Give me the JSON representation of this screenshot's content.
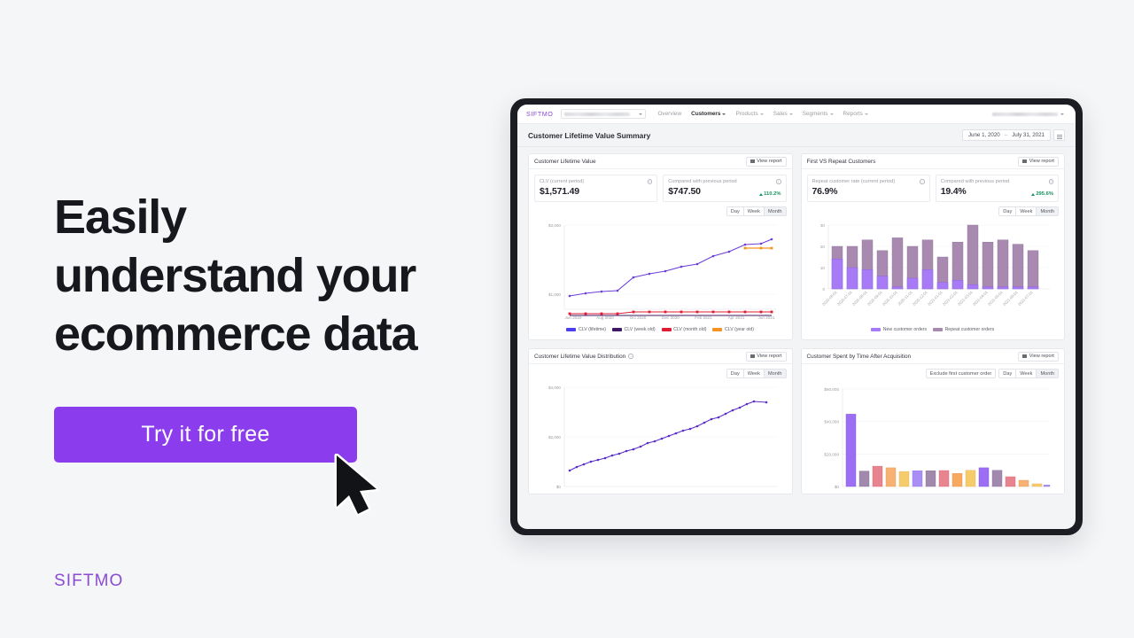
{
  "hero": {
    "headline_lines": [
      "Easily",
      "understand your",
      "ecommerce data"
    ],
    "cta_label": "Try it for free",
    "brand": "SIFTMO",
    "cta_color": "#8b3dee",
    "brand_color": "#8b4ad4"
  },
  "app": {
    "brand": "SIFTMO",
    "store_selector_value": "",
    "nav": [
      {
        "label": "Overview",
        "caret": false,
        "active": false
      },
      {
        "label": "Customers",
        "caret": true,
        "active": true
      },
      {
        "label": "Products",
        "caret": true,
        "active": false
      },
      {
        "label": "Sales",
        "caret": true,
        "active": false
      },
      {
        "label": "Segments",
        "caret": true,
        "active": false
      },
      {
        "label": "Reports",
        "caret": true,
        "active": false
      }
    ],
    "page_title": "Customer Lifetime Value Summary",
    "date_start": "June 1, 2020",
    "date_end": "July 31, 2021",
    "date_separator": "–",
    "view_report_label": "View report"
  },
  "cards": {
    "clv": {
      "title": "Customer Lifetime Value",
      "kpis": [
        {
          "label": "CLV (current period)",
          "value": "$1,571.49",
          "delta": null
        },
        {
          "label": "Compared with previous period",
          "value": "$747.50",
          "delta": "110.2%"
        }
      ],
      "toggle": [
        "Day",
        "Week",
        "Month"
      ],
      "toggle_selected": "Month"
    },
    "repeat": {
      "title": "First VS Repeat Customers",
      "kpis": [
        {
          "label": "Repeat customer rate (current period)",
          "value": "76.9%",
          "delta": null
        },
        {
          "label": "Compared with previous period",
          "value": "19.4%",
          "delta": "295.6%"
        }
      ],
      "toggle": [
        "Day",
        "Week",
        "Month"
      ],
      "toggle_selected": "Month"
    },
    "distribution": {
      "title": "Customer Lifetime Value Distribution",
      "has_info": true,
      "toggle": [
        "Day",
        "Week",
        "Month"
      ],
      "toggle_selected": "Month"
    },
    "spent": {
      "title": "Customer Spent by Time After Acquisition",
      "exclude_label": "Exclude first customer order",
      "toggle": [
        "Day",
        "Week",
        "Month"
      ],
      "toggle_selected": "Month"
    }
  },
  "chart_data": [
    {
      "id": "clv-line",
      "type": "line",
      "title": "Customer Lifetime Value",
      "xlabel": "",
      "ylabel": "",
      "ylim": [
        0,
        3000
      ],
      "yticks": [
        1000,
        3000
      ],
      "ytick_labels": [
        "$1,000",
        "$3,000"
      ],
      "grid": true,
      "legend_position": "bottom",
      "x": [
        "Jun 2020",
        "Jul 2020",
        "Aug 2020",
        "Sep 2020",
        "Oct 2020",
        "Nov 2020",
        "Dec 2020",
        "Jan 2021",
        "Feb 2021",
        "Mar 2021",
        "Apr 2021",
        "May 2021",
        "Jun 2021",
        "Jul 2021"
      ],
      "xtick_labels": [
        "Jun 2020",
        "Aug 2020",
        "Oct 2020",
        "Dec 2020",
        "Feb 2021",
        "Apr 2021",
        "Jun 2021"
      ],
      "series": [
        {
          "name": "CLV (lifetime)",
          "color": "#6b3fd6",
          "values": [
            940,
            1000,
            1040,
            1060,
            1340,
            1420,
            1470,
            1570,
            1620,
            1800,
            1890,
            2060,
            2080,
            2200
          ]
        },
        {
          "name": "CLV (week old)",
          "color": "#3d1a63",
          "values": [
            520,
            520,
            520,
            520,
            520,
            520,
            520,
            520,
            520,
            520,
            520,
            520,
            520,
            520
          ]
        },
        {
          "name": "CLV (month old)",
          "color": "#e01b34",
          "values": [
            560,
            560,
            560,
            560,
            600,
            600,
            600,
            600,
            600,
            600,
            600,
            600,
            600,
            600
          ]
        },
        {
          "name": "CLV (year old)",
          "color": "#f59324",
          "values": [
            null,
            null,
            null,
            null,
            null,
            null,
            null,
            null,
            null,
            null,
            null,
            1980,
            1980,
            1980
          ]
        }
      ]
    },
    {
      "id": "first-vs-repeat",
      "type": "bar",
      "title": "First VS Repeat Customers",
      "stacked": true,
      "ylim": [
        0,
        32
      ],
      "yticks": [
        0,
        10,
        20,
        30
      ],
      "ytick_labels": [
        "0",
        "10",
        "20",
        "30"
      ],
      "grid": true,
      "legend_position": "bottom",
      "categories": [
        "2020-06-01",
        "2020-07-01",
        "2020-08-01",
        "2020-09-01",
        "2020-10-01",
        "2020-11-01",
        "2020-12-01",
        "2021-01-01",
        "2021-02-01",
        "2021-03-01",
        "2021-04-01",
        "2021-05-01",
        "2021-06-01",
        "2021-07-01"
      ],
      "series": [
        {
          "name": "New customer orders",
          "color": "#a77bf5",
          "values": [
            14,
            10,
            9,
            6,
            1,
            5,
            9,
            3,
            4,
            2,
            1,
            1,
            1,
            1
          ]
        },
        {
          "name": "Repeat customer orders",
          "color": "#a88ab0",
          "values": [
            6,
            10,
            14,
            12,
            23,
            15,
            14,
            12,
            18,
            28,
            21,
            22,
            20,
            17
          ]
        }
      ]
    },
    {
      "id": "clv-distribution",
      "type": "line",
      "title": "Customer Lifetime Value Distribution",
      "ylim": [
        0,
        4000
      ],
      "yticks": [
        0,
        2000,
        4000
      ],
      "ytick_labels": [
        "$0",
        "$2,000",
        "$4,000"
      ],
      "grid": true,
      "series": [
        {
          "name": "CLV",
          "color": "#5b2fc9",
          "values": [
            650,
            790,
            880,
            980,
            1080,
            1160,
            1250,
            1340,
            1420,
            1510,
            1620,
            1740,
            1830,
            1920,
            2020,
            2130,
            2250,
            2320,
            2430,
            2560,
            2700,
            2800,
            2920,
            3060,
            3190,
            3320,
            3420,
            3390
          ]
        }
      ]
    },
    {
      "id": "spent-after-acquisition",
      "type": "bar",
      "title": "Customer Spent by Time After Acquisition",
      "ylim": [
        0,
        60000
      ],
      "yticks": [
        0,
        20000,
        40000,
        60000
      ],
      "ytick_labels": [
        "$0",
        "$20,000",
        "$40,000",
        "$60,000"
      ],
      "grid": true,
      "values": [
        44500,
        9500,
        12500,
        11500,
        9200,
        9700,
        9700,
        9800,
        8000,
        10000,
        11500,
        9900,
        6000,
        3800,
        1600,
        700
      ],
      "colors": [
        "#9b6ef3",
        "#a189ad",
        "#e8848f",
        "#f6b173",
        "#f5cb6b",
        "#a98ef5",
        "#a189ad",
        "#e8848f",
        "#f6a95f",
        "#f5cb6b",
        "#9b6ef3",
        "#a189ad",
        "#e8848f",
        "#f6b173",
        "#f5cb6b",
        "#a98ef5"
      ]
    }
  ]
}
